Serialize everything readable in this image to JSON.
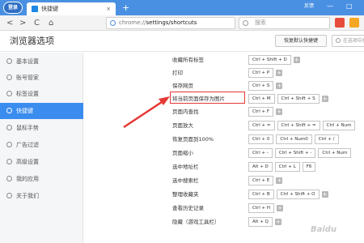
{
  "titlebar": {
    "logo_text": "登录",
    "tab_title": "快捷键",
    "tab_close": "×",
    "new_tab": "+",
    "feedback": "反馈",
    "minimize": "—",
    "restore": "□"
  },
  "toolbar": {
    "back": "<",
    "forward": ">",
    "reload": "C",
    "home": "⌂",
    "address_scheme": "chrome://",
    "address_path": "settings/shortcuts",
    "search_placeholder": "搜索"
  },
  "header": {
    "title": "浏览器选项",
    "reset_button": "恢复默认快捷键",
    "search_placeholder": "在选项中搜索"
  },
  "sidebar": {
    "items": [
      {
        "label": "基本设置",
        "active": false
      },
      {
        "label": "账号管家",
        "active": false
      },
      {
        "label": "标签设置",
        "active": false
      },
      {
        "label": "快捷键",
        "active": true
      },
      {
        "label": "鼠标手势",
        "active": false
      },
      {
        "label": "广告过滤",
        "active": false
      },
      {
        "label": "高级设置",
        "active": false
      },
      {
        "label": "我的应用",
        "active": false
      },
      {
        "label": "关于我们",
        "active": false
      }
    ]
  },
  "shortcuts": [
    {
      "label": "收藏所有标签",
      "keys": [
        "Ctrl + Shift + D"
      ]
    },
    {
      "label": "打印",
      "keys": [
        "Ctrl + P"
      ]
    },
    {
      "label": "保存网页",
      "keys": [
        "Ctrl + S"
      ]
    },
    {
      "label": "将当前页面保存为图片",
      "keys": [
        "Ctrl + M",
        "Ctrl + Shift + S"
      ]
    },
    {
      "label": "页面内查找",
      "keys": [
        "Ctrl + F"
      ]
    },
    {
      "label": "页面放大",
      "keys": [
        "Ctrl + =",
        "Ctrl + Shift + =",
        "Ctrl + Num"
      ]
    },
    {
      "label": "恢复页面到100%",
      "keys": [
        "Ctrl + 0",
        "Ctrl + Num0",
        "Ctrl + /"
      ]
    },
    {
      "label": "页面缩小",
      "keys": [
        "Ctrl + -",
        "Ctrl + Shift + -",
        "Ctrl + Num"
      ]
    },
    {
      "label": "选中地址栏",
      "keys": [
        "Alt + D",
        "Ctrl + L",
        "F6"
      ]
    },
    {
      "label": "选中搜索栏",
      "keys": [
        "Ctrl + E"
      ]
    },
    {
      "label": "整理收藏夹",
      "keys": [
        "Ctrl + B",
        "Ctrl + Shift + O"
      ]
    },
    {
      "label": "查看历史记录",
      "keys": [
        "Ctrl + H"
      ]
    },
    {
      "label": "隐藏（游戏工具栏）",
      "keys": [
        "Alt + Q"
      ]
    }
  ],
  "add_glyph": "+",
  "watermark": "Baidu",
  "colors": {
    "titlebar": "#4a90e2",
    "sidebar_active": "#3b8cef",
    "annotation_red": "#e53935"
  }
}
